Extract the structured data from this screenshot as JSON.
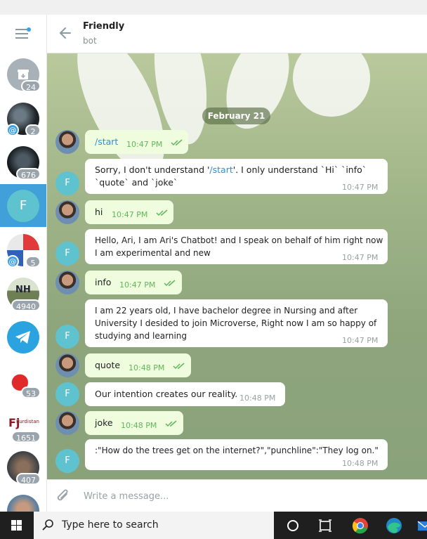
{
  "header": {
    "title": "Friendly",
    "subtitle": "bot"
  },
  "sidebar": {
    "chats": [
      {
        "badge": "24"
      },
      {
        "badge": "2",
        "mention": "@"
      },
      {
        "badge": "676"
      },
      {
        "letter": "F",
        "active": true
      },
      {
        "badge": "5",
        "mention": "@"
      },
      {
        "badge": "4940",
        "tag": "NH"
      },
      {
        "badge": ""
      },
      {
        "badge": "53"
      },
      {
        "badge": "1651",
        "tag": "Kurdistan"
      },
      {
        "badge": "407"
      }
    ]
  },
  "date_label": "February 21",
  "messages": [
    {
      "dir": "out",
      "text": "/start",
      "time": "10:47 PM"
    },
    {
      "dir": "in",
      "text_a": "Sorry, I don't understand '",
      "text_link": "/start",
      "text_b": "'. I only understand `Hi` `info`",
      "text_line2": "`quote` and `joke`",
      "time": "10:47 PM",
      "avatar": "F"
    },
    {
      "dir": "out",
      "text": "hi",
      "time": "10:47 PM"
    },
    {
      "dir": "in",
      "line1": "Hello, Ari, I am Ari's Chatbot! and I speak on behalf of him right now",
      "line2": "I am experimental and new",
      "time": "10:47 PM",
      "avatar": "F"
    },
    {
      "dir": "out",
      "text": "info",
      "time": "10:47 PM"
    },
    {
      "dir": "in",
      "line1": "I am 22 years old, I have bachelor degree in Nursing and after",
      "line2": "University I desided to join Microverse, Right now I am so happy of",
      "line3": "studying and learning",
      "time": "10:47 PM",
      "avatar": "F"
    },
    {
      "dir": "out",
      "text": "quote",
      "time": "10:48 PM"
    },
    {
      "dir": "in",
      "text": "Our intention creates our reality.",
      "time": "10:48 PM",
      "avatar": "F"
    },
    {
      "dir": "out",
      "text": "joke",
      "time": "10:48 PM"
    },
    {
      "dir": "in",
      "text": ":\"How do the trees get on the internet?\",\"punchline\":\"They log on.\"",
      "time": "10:48 PM",
      "avatar": "F"
    }
  ],
  "composer": {
    "placeholder": "Write a message..."
  },
  "taskbar": {
    "search_placeholder": "Type here to search"
  },
  "colors": {
    "accent": "#419fd9",
    "outgoing_bubble": "#effdde",
    "incoming_bubble": "#ffffff",
    "check_green": "#5fb75a"
  },
  "icons": [
    "menu-icon",
    "back-arrow-icon",
    "double-check-icon",
    "paperclip-icon",
    "windows-icon",
    "search-icon",
    "cortana-icon",
    "task-view-icon",
    "chrome-icon",
    "edge-icon",
    "mail-icon",
    "telegram-icon"
  ]
}
